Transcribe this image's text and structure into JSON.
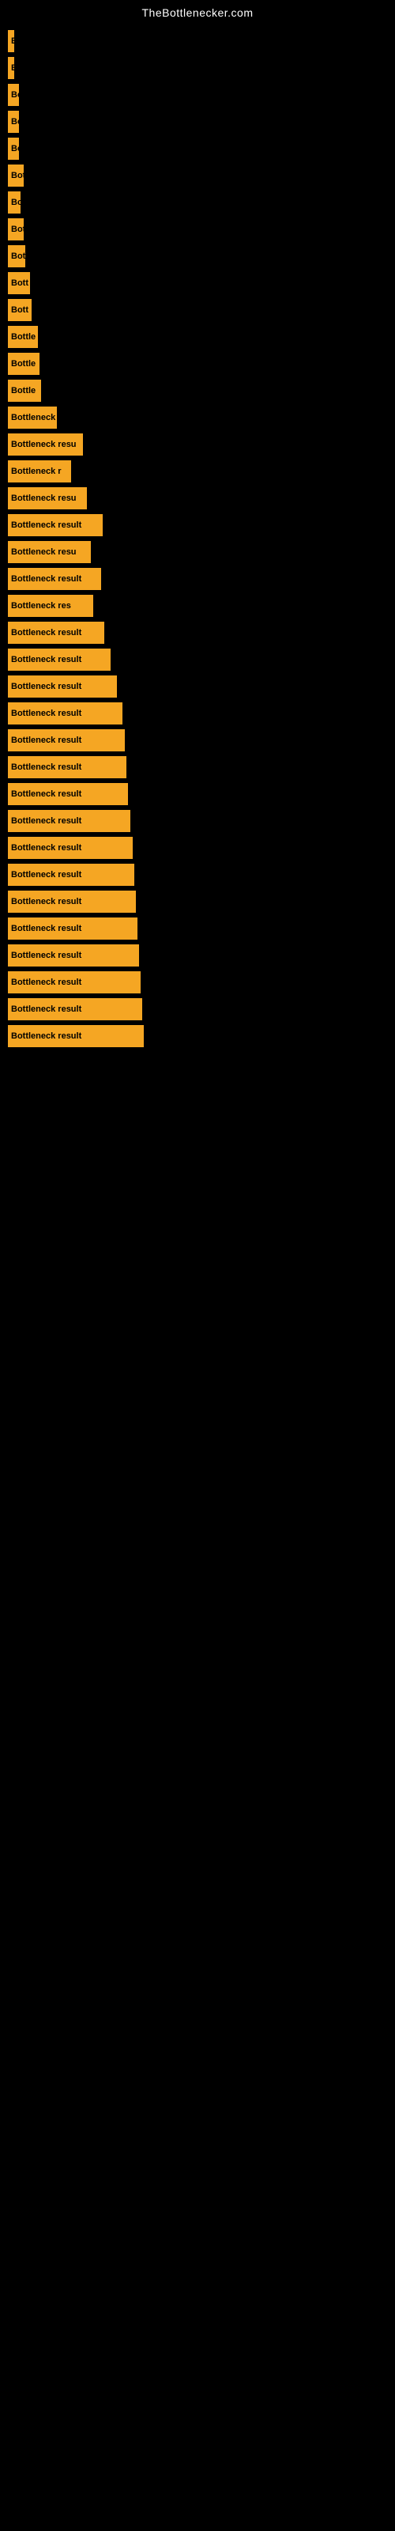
{
  "site": {
    "title": "TheBottlenecker.com"
  },
  "bars": [
    {
      "id": 1,
      "label": "B",
      "width": 8
    },
    {
      "id": 2,
      "label": "B",
      "width": 8
    },
    {
      "id": 3,
      "label": "Bo",
      "width": 14
    },
    {
      "id": 4,
      "label": "Bo",
      "width": 14
    },
    {
      "id": 5,
      "label": "Bo",
      "width": 14
    },
    {
      "id": 6,
      "label": "Bot",
      "width": 20
    },
    {
      "id": 7,
      "label": "Bo",
      "width": 16
    },
    {
      "id": 8,
      "label": "Bot",
      "width": 20
    },
    {
      "id": 9,
      "label": "Bot",
      "width": 22
    },
    {
      "id": 10,
      "label": "Bott",
      "width": 28
    },
    {
      "id": 11,
      "label": "Bott",
      "width": 30
    },
    {
      "id": 12,
      "label": "Bottle",
      "width": 38
    },
    {
      "id": 13,
      "label": "Bottle",
      "width": 40
    },
    {
      "id": 14,
      "label": "Bottle",
      "width": 42
    },
    {
      "id": 15,
      "label": "Bottleneck",
      "width": 62
    },
    {
      "id": 16,
      "label": "Bottleneck resu",
      "width": 95
    },
    {
      "id": 17,
      "label": "Bottleneck r",
      "width": 80
    },
    {
      "id": 18,
      "label": "Bottleneck resu",
      "width": 100
    },
    {
      "id": 19,
      "label": "Bottleneck result",
      "width": 120
    },
    {
      "id": 20,
      "label": "Bottleneck resu",
      "width": 105
    },
    {
      "id": 21,
      "label": "Bottleneck result",
      "width": 118
    },
    {
      "id": 22,
      "label": "Bottleneck res",
      "width": 108
    },
    {
      "id": 23,
      "label": "Bottleneck result",
      "width": 122
    },
    {
      "id": 24,
      "label": "Bottleneck result",
      "width": 130
    },
    {
      "id": 25,
      "label": "Bottleneck result",
      "width": 138
    },
    {
      "id": 26,
      "label": "Bottleneck result",
      "width": 145
    },
    {
      "id": 27,
      "label": "Bottleneck result",
      "width": 148
    },
    {
      "id": 28,
      "label": "Bottleneck result",
      "width": 150
    },
    {
      "id": 29,
      "label": "Bottleneck result",
      "width": 152
    },
    {
      "id": 30,
      "label": "Bottleneck result",
      "width": 155
    },
    {
      "id": 31,
      "label": "Bottleneck result",
      "width": 158
    },
    {
      "id": 32,
      "label": "Bottleneck result",
      "width": 160
    },
    {
      "id": 33,
      "label": "Bottleneck result",
      "width": 162
    },
    {
      "id": 34,
      "label": "Bottleneck result",
      "width": 164
    },
    {
      "id": 35,
      "label": "Bottleneck result",
      "width": 166
    },
    {
      "id": 36,
      "label": "Bottleneck result",
      "width": 168
    },
    {
      "id": 37,
      "label": "Bottleneck result",
      "width": 170
    },
    {
      "id": 38,
      "label": "Bottleneck result",
      "width": 172
    }
  ]
}
